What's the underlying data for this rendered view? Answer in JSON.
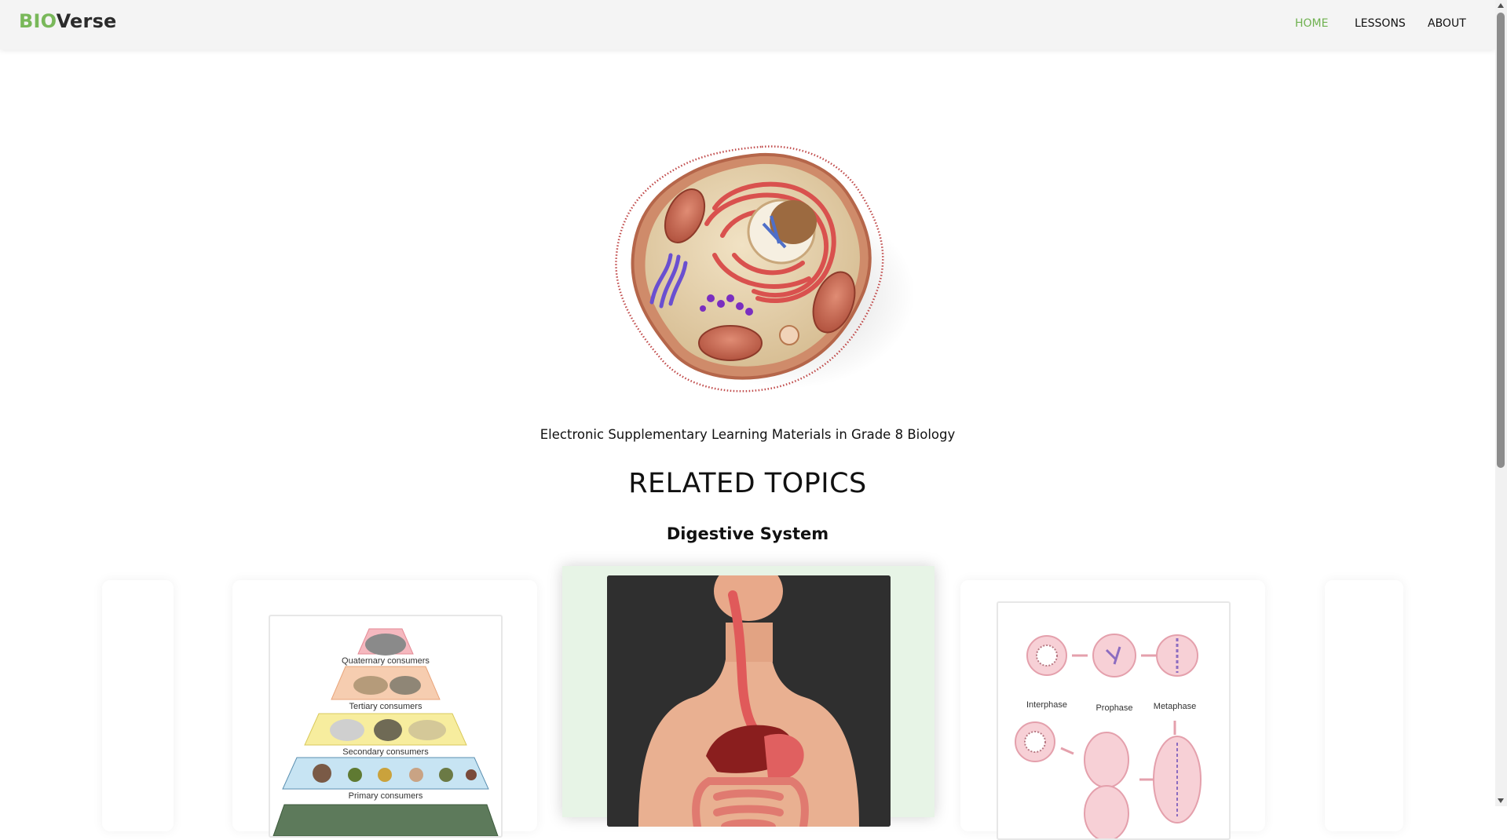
{
  "brand": {
    "prefix": "BIO",
    "suffix": "Verse"
  },
  "nav": {
    "items": [
      {
        "label": "HOME",
        "active": true
      },
      {
        "label": "LESSONS",
        "active": false
      },
      {
        "label": "ABOUT",
        "active": false
      }
    ]
  },
  "hero": {
    "image_icon": "animal-cell-icon",
    "subtitle": "Electronic Supplementary Learning Materials in Grade 8 Biology"
  },
  "related": {
    "title": "RELATED TOPICS",
    "current_topic": "Digestive System",
    "cards": [
      {
        "image_icon": "food-pyramid-icon",
        "levels": [
          "Quaternary consumers",
          "Tertiary consumers",
          "Secondary consumers",
          "Primary consumers"
        ]
      },
      {
        "image_icon": "digestive-system-icon"
      },
      {
        "image_icon": "cell-division-icon",
        "phases": [
          "Interphase",
          "Prophase",
          "Metaphase"
        ]
      }
    ]
  },
  "colors": {
    "accent": "#79b85a",
    "active_nav": "#6fb150",
    "carousel_highlight": "#e7f4e6"
  }
}
